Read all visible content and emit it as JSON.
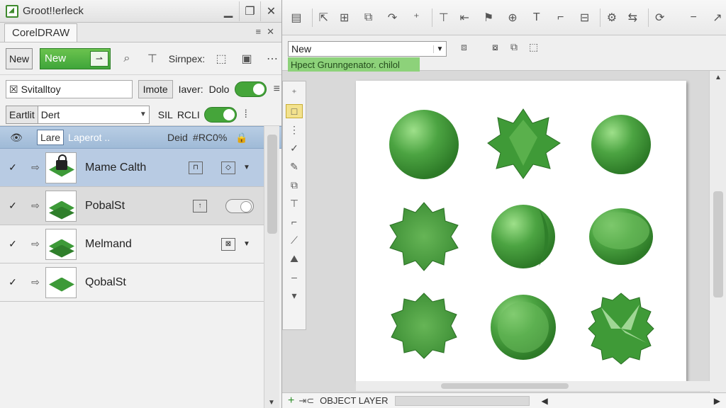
{
  "docker": {
    "title": "Groot!!erleck",
    "tab": "CorelDRAW",
    "toolbar": {
      "new_small": "New",
      "new_primary": "New",
      "simpex": "Sirnpex:"
    },
    "row2": {
      "field": "Svitalltoy",
      "button": "Imote",
      "label": "Iaver:",
      "value": "Dolo"
    },
    "row3": {
      "combo_label": "Eartlit",
      "combo_value": "Dert",
      "label1": "SIL",
      "label2": "RCLI"
    },
    "layer_header": {
      "box": "Lare",
      "name": "Laperot ..",
      "col1": "Deid",
      "col2": "#RC0%"
    },
    "layers": [
      {
        "name": "Mame Calth",
        "selected": true
      },
      {
        "name": "PobalSt",
        "selected": false
      },
      {
        "name": "Melmand",
        "selected": false
      },
      {
        "name": "QobalSt",
        "selected": false
      }
    ]
  },
  "workspace": {
    "property_combo": "New",
    "hint": "Hpect Grunngenator. chilol",
    "statusbar_text": "OBJECT LAYER"
  },
  "colors": {
    "accent_green": "#3fa53a",
    "selection_blue": "#b8cbe3",
    "hint_green": "#8dd27a"
  }
}
